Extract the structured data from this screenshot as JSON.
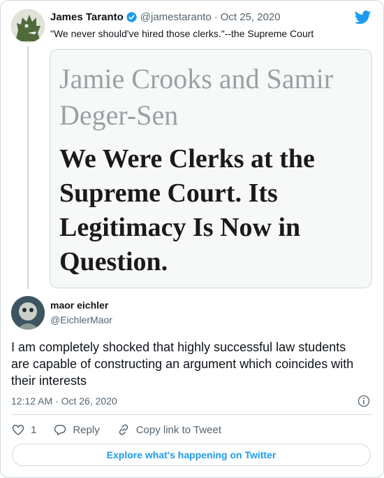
{
  "colors": {
    "accent": "#1d9bf0",
    "muted": "#536471",
    "border": "#cfd9de"
  },
  "quoted_tweet": {
    "author_name": "James Taranto",
    "handle": "@jamestaranto",
    "separator": "·",
    "date": "Oct 25, 2020",
    "text": "\"We never should've hired those clerks.\"--the Supreme Court",
    "verified_icon": "verified-badge-icon",
    "card": {
      "authors": "Jamie Crooks and Samir Deger-Sen",
      "headline": "We Were Clerks at the Supreme Court. Its Legitimacy Is Now in Question."
    }
  },
  "reply_tweet": {
    "author_name": "maor eichler",
    "handle": "@EichlerMaor",
    "text": "I am completely shocked that highly successful law students are capable of constructing an argument which coincides with their interests",
    "timestamp": "12:12 AM · Oct 26, 2020"
  },
  "actions": {
    "like_count": "1",
    "reply_label": "Reply",
    "copy_link_label": "Copy link to Tweet"
  },
  "explore_label": "Explore what's happening on Twitter"
}
